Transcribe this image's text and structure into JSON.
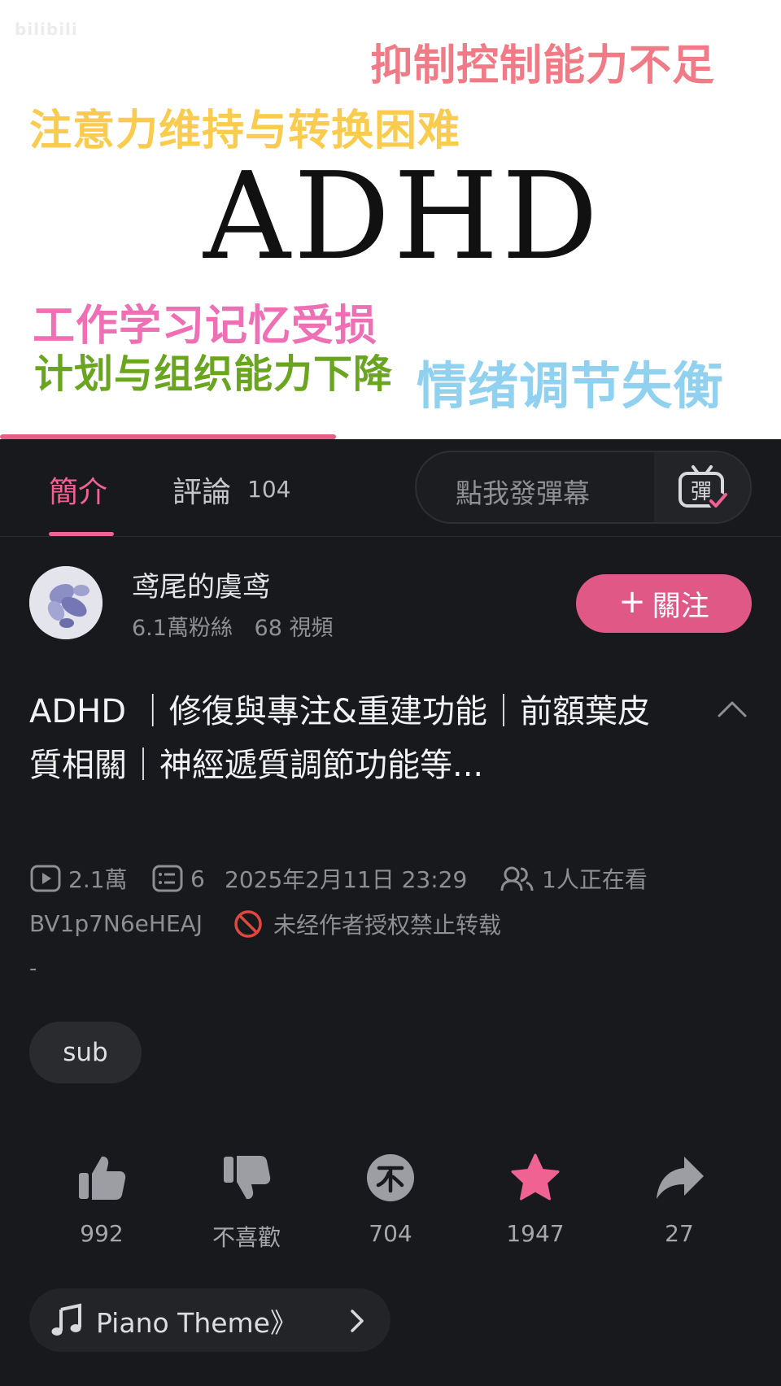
{
  "video": {
    "watermark": "bilibili",
    "overlay_texts": [
      "抑制控制能力不足",
      "注意力维持与转换困难",
      "ADHD",
      "工作学习记忆受损",
      "计划与组织能力下降",
      "情绪调节失衡"
    ],
    "progress_fraction": 0.43
  },
  "tabs": {
    "intro": "簡介",
    "comments": "評論",
    "comments_count": "104"
  },
  "danmaku": {
    "placeholder": "點我發彈幕",
    "icon_char": "彈"
  },
  "uploader": {
    "name": "鸢尾的虞鸢",
    "followers": "6.1萬粉絲",
    "videos": "68 視頻",
    "follow_label": "關注",
    "follow_plus": "+"
  },
  "title": "ADHD ｜修復與專注&重建功能｜前額葉皮質相關｜神經遞質調節功能等...",
  "meta": {
    "views": "2.1萬",
    "danmaku_count": "6",
    "date": "2025年2月11日 23:29",
    "watching": "1人正在看",
    "bvid": "BV1p7N6eHEAJ",
    "copyright": "未经作者授权禁止转载",
    "description": "-"
  },
  "tags": [
    "sub"
  ],
  "actions": {
    "like": "992",
    "dislike": "不喜歡",
    "coin": "704",
    "favorite": "1947",
    "share": "27"
  },
  "bgm": {
    "text": "Piano Theme》"
  },
  "colors": {
    "accent": "#f06292",
    "follow": "#e05885",
    "background": "#18191c"
  }
}
